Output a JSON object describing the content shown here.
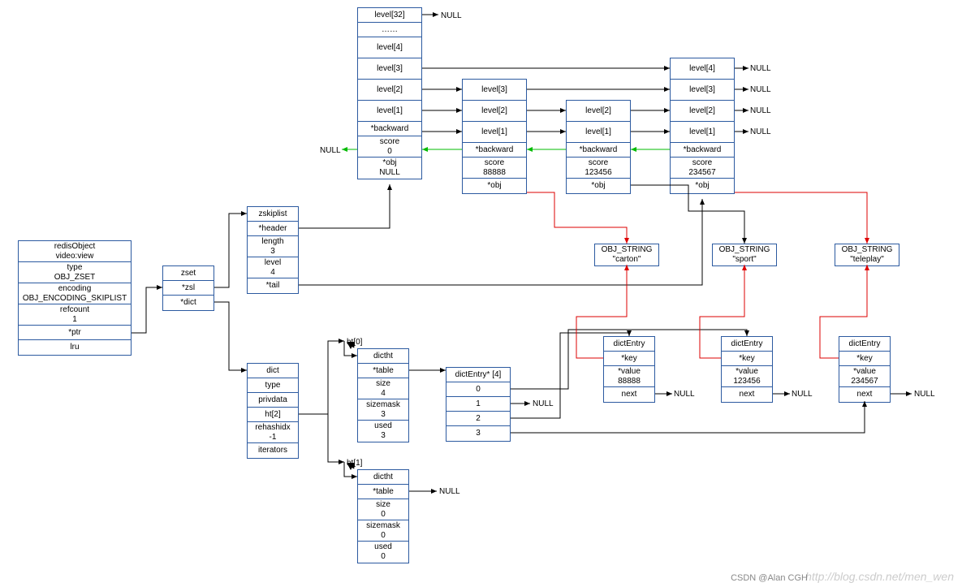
{
  "redisObject": {
    "title": "redisObject\nvideo:view",
    "r0": "type\nOBJ_ZSET",
    "r1": "encoding\nOBJ_ENCODING_SKIPLIST",
    "r2": "refcount\n1",
    "r3": "*ptr",
    "r4": "lru"
  },
  "zset": {
    "title": "zset",
    "r0": "*zsl",
    "r1": "*dict"
  },
  "zskiplist": {
    "title": "zskiplist",
    "r0": "*header",
    "r1": "length\n3",
    "r2": "level\n4",
    "r3": "*tail"
  },
  "dict": {
    "title": "dict",
    "r0": "type",
    "r1": "privdata",
    "r2": "ht[2]",
    "r3": "rehashidx\n-1",
    "r4": "iterators"
  },
  "dictht0_lbl": "ht[0]",
  "dictht0": {
    "title": "dictht",
    "r0": "*table",
    "r1": "size\n4",
    "r2": "sizemask\n3",
    "r3": "used\n3"
  },
  "dictht1_lbl": "ht[1]",
  "dictht1": {
    "title": "dictht",
    "r0": "*table",
    "r1": "size\n0",
    "r2": "sizemask\n0",
    "r3": "used\n0"
  },
  "dictentryarr": {
    "title": "dictEntry* [4]",
    "r0": "0",
    "r1": "1",
    "r2": "2",
    "r3": "3"
  },
  "null": "NULL",
  "header_node": {
    "l32": "level[32]",
    "ldots": "……",
    "l4": "level[4]",
    "l3": "level[3]",
    "l2": "level[2]",
    "l1": "level[1]",
    "bw": "*backward",
    "score": "score\n0",
    "obj": "*obj\nNULL"
  },
  "nodeB": {
    "l3": "level[3]",
    "l2": "level[2]",
    "l1": "level[1]",
    "bw": "*backward",
    "score": "score\n88888",
    "obj": "*obj"
  },
  "nodeC": {
    "l2": "level[2]",
    "l1": "level[1]",
    "bw": "*backward",
    "score": "score\n123456",
    "obj": "*obj"
  },
  "nodeD": {
    "l4": "level[4]",
    "l3": "level[3]",
    "l2": "level[2]",
    "l1": "level[1]",
    "bw": "*backward",
    "score": "score\n234567",
    "obj": "*obj"
  },
  "objstr": {
    "b": "OBJ_STRING\n\"carton\"",
    "c": "OBJ_STRING\n\"sport\"",
    "d": "OBJ_STRING\n\"teleplay\""
  },
  "dictEntry1": {
    "title": "dictEntry",
    "k": "*key",
    "v": "*value\n88888",
    "n": "next"
  },
  "dictEntry2": {
    "title": "dictEntry",
    "k": "*key",
    "v": "*value\n123456",
    "n": "next"
  },
  "dictEntry3": {
    "title": "dictEntry",
    "k": "*key",
    "v": "*value\n234567",
    "n": "next"
  },
  "watermark": "http://blog.csdn.net/men_wen",
  "csdn": "CSDN @Alan CGH"
}
